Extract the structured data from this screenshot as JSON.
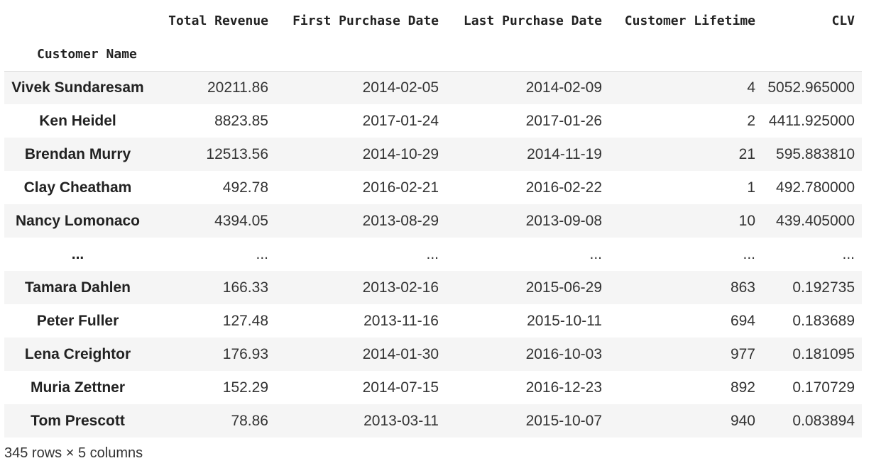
{
  "table": {
    "columns": [
      "Total Revenue",
      "First Purchase Date",
      "Last Purchase Date",
      "Customer Lifetime",
      "CLV"
    ],
    "index_name": "Customer Name",
    "rows": [
      {
        "name": "Vivek Sundaresam",
        "cells": [
          "20211.86",
          "2014-02-05",
          "2014-02-09",
          "4",
          "5052.965000"
        ]
      },
      {
        "name": "Ken Heidel",
        "cells": [
          "8823.85",
          "2017-01-24",
          "2017-01-26",
          "2",
          "4411.925000"
        ]
      },
      {
        "name": "Brendan Murry",
        "cells": [
          "12513.56",
          "2014-10-29",
          "2014-11-19",
          "21",
          "595.883810"
        ]
      },
      {
        "name": "Clay Cheatham",
        "cells": [
          "492.78",
          "2016-02-21",
          "2016-02-22",
          "1",
          "492.780000"
        ]
      },
      {
        "name": "Nancy Lomonaco",
        "cells": [
          "4394.05",
          "2013-08-29",
          "2013-09-08",
          "10",
          "439.405000"
        ]
      },
      {
        "name": "...",
        "cells": [
          "...",
          "...",
          "...",
          "...",
          "..."
        ]
      },
      {
        "name": "Tamara Dahlen",
        "cells": [
          "166.33",
          "2013-02-16",
          "2015-06-29",
          "863",
          "0.192735"
        ]
      },
      {
        "name": "Peter Fuller",
        "cells": [
          "127.48",
          "2013-11-16",
          "2015-10-11",
          "694",
          "0.183689"
        ]
      },
      {
        "name": "Lena Creightor",
        "cells": [
          "176.93",
          "2014-01-30",
          "2016-10-03",
          "977",
          "0.181095"
        ]
      },
      {
        "name": "Muria Zettner",
        "cells": [
          "152.29",
          "2014-07-15",
          "2016-12-23",
          "892",
          "0.170729"
        ]
      },
      {
        "name": "Tom Prescott",
        "cells": [
          "78.86",
          "2013-03-11",
          "2015-10-07",
          "940",
          "0.083894"
        ]
      }
    ]
  },
  "footer": "345 rows × 5 columns"
}
